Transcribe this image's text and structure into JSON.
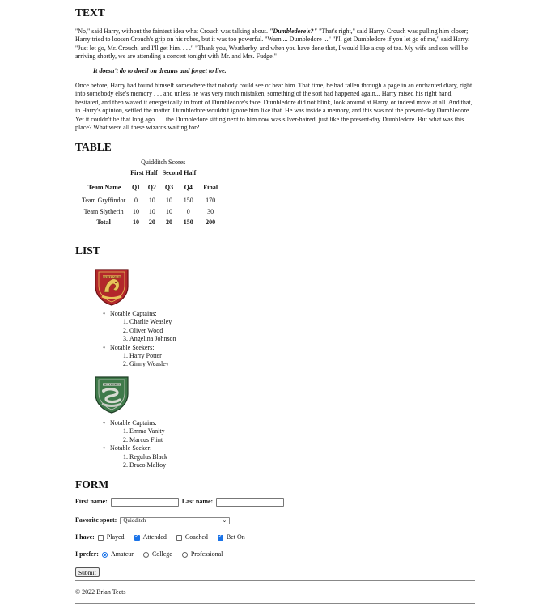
{
  "sections": {
    "text_heading": "TEXT",
    "table_heading": "TABLE",
    "list_heading": "LIST",
    "form_heading": "FORM"
  },
  "text": {
    "para1_a": "\"No,\" said Harry, without the faintest idea what Crouch was talking about. ",
    "para1_b": "\"Dumbledore's?\"",
    "para1_c": " \"That's right,\" said Harry. Crouch was pulling him closer; Harry tried to loosen Crouch's grip on his robes, but it was too powerful. \"Warn ... Dumbledore ...\" \"I'll get Dumbledore if you let go of me,\" said Harry. \"Just let go, Mr. Crouch, and I'll get him. . . .\" \"Thank you, Weatherby, and when you have done that, I would like a cup of tea. My wife and son will be arriving shortly, we are attending a concert tonight with Mr. and Mrs. Fudge.\"",
    "quote": "It doesn't do to dwell on dreams and forget to live.",
    "para2": "Once before, Harry had found himself somewhere that nobody could see or hear him. That time, he had fallen through a page in an enchanted diary, right into somebody else's memory . . . and unless he was very much mistaken, something of the sort had happened again... Harry raised his right hand, hesitated, and then waved it energetically in front of Dumbledore's face. Dumbledore did not blink, look around at Harry, or indeed move at all. And that, in Harry's opinion, settled the matter. Dumbledore wouldn't ignore him like that. He was inside a memory, and this was not the present-day Dumbledore. Yet it couldn't be that long ago . . . the Dumbledore sitting next to him now was silver-haired, just like the present-day Dumbledore. But what was this place? What were all these wizards waiting for?"
  },
  "table": {
    "caption": "Quidditch Scores",
    "group_headers": [
      "First Half",
      "Second Half"
    ],
    "columns": [
      "Team Name",
      "Q1",
      "Q2",
      "Q3",
      "Q4",
      "Final"
    ],
    "rows": [
      [
        "Team Gryffindor",
        "0",
        "10",
        "10",
        "150",
        "170"
      ],
      [
        "Team Slytherin",
        "10",
        "10",
        "10",
        "0",
        "30"
      ]
    ],
    "total": [
      "Total",
      "10",
      "20",
      "20",
      "150",
      "200"
    ]
  },
  "houses": [
    {
      "crest_label": "GRYFFINDOR",
      "crest_color": "#b3272b",
      "crest_accent": "#e8c35a",
      "groups": [
        {
          "label": "Notable Captains:",
          "names": [
            "Charlie Weasley",
            "Oliver Wood",
            "Angelina Johnson"
          ]
        },
        {
          "label": "Notable Seekers:",
          "names": [
            "Harry Potter",
            "Ginny Weasley"
          ]
        }
      ]
    },
    {
      "crest_label": "SLYTHERIN",
      "crest_color": "#3f7a4a",
      "crest_accent": "#c9ccc4",
      "groups": [
        {
          "label": "Notable Captains:",
          "names": [
            "Emma Vanity",
            "Marcus Flint"
          ]
        },
        {
          "label": "Notable Seeker:",
          "names": [
            "Regulus Black",
            "Draco Malfoy"
          ]
        }
      ]
    }
  ],
  "form": {
    "first_name_label": "First name:",
    "first_name_value": "",
    "last_name_label": "Last name:",
    "last_name_value": "",
    "sport_label": "Favorite sport:",
    "sport_selected": "Quidditch",
    "have_label": "I have:",
    "checkboxes": [
      {
        "label": "Played",
        "checked": false
      },
      {
        "label": "Attended",
        "checked": true
      },
      {
        "label": "Coached",
        "checked": false
      },
      {
        "label": "Bet On",
        "checked": true
      }
    ],
    "prefer_label": "I prefer:",
    "radios": [
      {
        "label": "Amateur",
        "checked": true
      },
      {
        "label": "College",
        "checked": false
      },
      {
        "label": "Professional",
        "checked": false
      }
    ],
    "submit_label": "Submit"
  },
  "footer": {
    "copyright": "© 2022   Brian Teets"
  },
  "icons": {
    "select_arrow": "chevron-down-icon"
  },
  "colors": {
    "accent": "#1a73e8"
  }
}
